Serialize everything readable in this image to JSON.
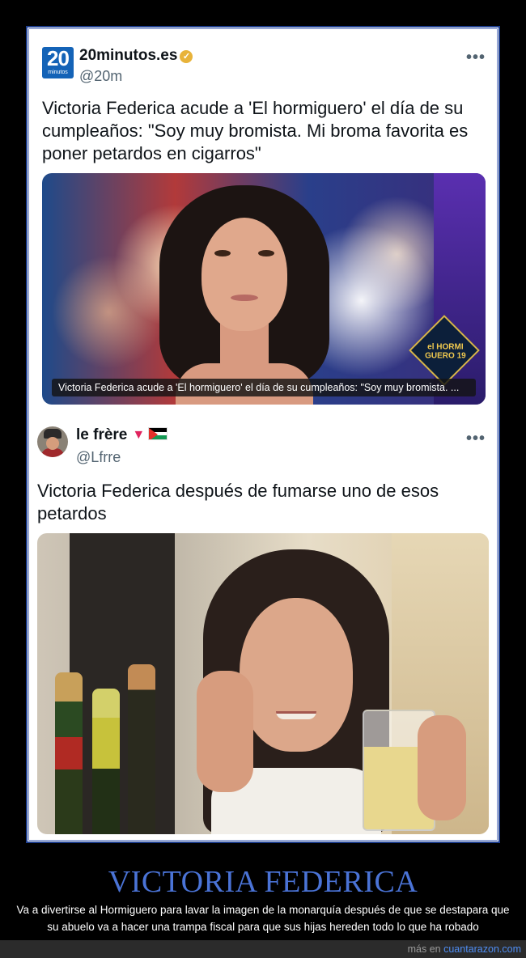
{
  "tweet1": {
    "logo_number": "20",
    "logo_sub": "minutos",
    "name": "20minutos.es",
    "handle": "@20m",
    "more": "•••",
    "text": "Victoria Federica acude a 'El hormiguero' el día de su cumpleaños: \"Soy muy bromista. Mi broma favorita es poner petardos en cigarros\"",
    "image_caption": "Victoria Federica acude a 'El hormiguero' el día de su cumpleaños: \"Soy muy bromista. ...",
    "badge": "el HORMI GUERO 19"
  },
  "tweet2": {
    "name": "le frère",
    "handle": "@Lfrre",
    "more": "•••",
    "text": "Victoria Federica después de fumarse uno de esos petardos"
  },
  "post": {
    "title": "VICTORIA FEDERICA",
    "description": "Va a divertirse al Hormiguero para lavar la imagen de la monarquía después de que se destapara que su abuelo va a hacer una trampa fiscal para que sus hijas hereden todo lo que ha robado"
  },
  "footer": {
    "prefix": "más en ",
    "link": "cuantarazon.com"
  },
  "colors": {
    "title": "#4a73d6",
    "link": "#4f8df2",
    "frame_border": "#1f3f8f"
  }
}
